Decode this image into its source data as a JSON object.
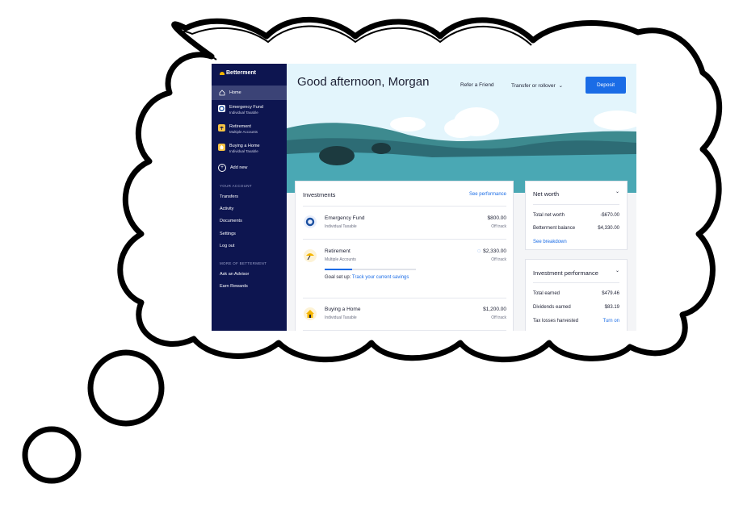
{
  "app": {
    "logo_text": "Betterment"
  },
  "sidebar": {
    "items": [
      {
        "label": "Home",
        "sub": "",
        "icon": "home-icon"
      },
      {
        "label": "Emergency Fund",
        "sub": "Individual Taxable",
        "icon": "lifebuoy-icon"
      },
      {
        "label": "Retirement",
        "sub": "Multiple Accounts",
        "icon": "umbrella-icon"
      },
      {
        "label": "Buying a Home",
        "sub": "Individual Taxable",
        "icon": "house-icon"
      },
      {
        "label": "Add new",
        "sub": "",
        "icon": "plus-icon"
      }
    ],
    "your_account_label": "YOUR ACCOUNT",
    "account_links": [
      "Transfers",
      "Activity",
      "Documents",
      "Settings",
      "Log out"
    ],
    "more_label": "MORE OF BETTERMENT",
    "more_links": [
      "Ask an Advisor",
      "Earn Rewards"
    ]
  },
  "header": {
    "greeting": "Good afternoon, Morgan",
    "refer_label": "Refer a Friend",
    "transfer_label": "Transfer or rollover",
    "deposit_label": "Deposit"
  },
  "investments": {
    "title": "Investments",
    "see_performance": "See performance",
    "accounts": [
      {
        "name": "Emergency Fund",
        "sub": "Individual Taxable",
        "amount": "$800.00",
        "status": "Off track",
        "icon": "lifebuoy-icon"
      },
      {
        "name": "Retirement",
        "sub": "Multiple Accounts",
        "amount": "$2,330.00",
        "status": "Off track",
        "icon": "umbrella-icon",
        "goal_prefix": "Goal set up:",
        "goal_link": "Track your current savings",
        "progress": 0.3
      },
      {
        "name": "Buying a Home",
        "sub": "Individual Taxable",
        "amount": "$1,200.00",
        "status": "Off track",
        "icon": "house-icon"
      }
    ]
  },
  "net_worth": {
    "title": "Net worth",
    "rows": [
      {
        "label": "Total net worth",
        "value": "-$670.00"
      },
      {
        "label": "Betterment balance",
        "value": "$4,330.00"
      }
    ],
    "link": "See breakdown"
  },
  "performance": {
    "title": "Investment performance",
    "rows": [
      {
        "label": "Total earned",
        "value": "$479.46"
      },
      {
        "label": "Dividends earned",
        "value": "$83.19"
      },
      {
        "label": "Tax losses harvested",
        "value": "Turn on"
      }
    ]
  },
  "colors": {
    "sidebar": "#0d1550",
    "accent": "#1a6ce6",
    "logo": "#f6b500",
    "water": "#4aa8b4"
  }
}
